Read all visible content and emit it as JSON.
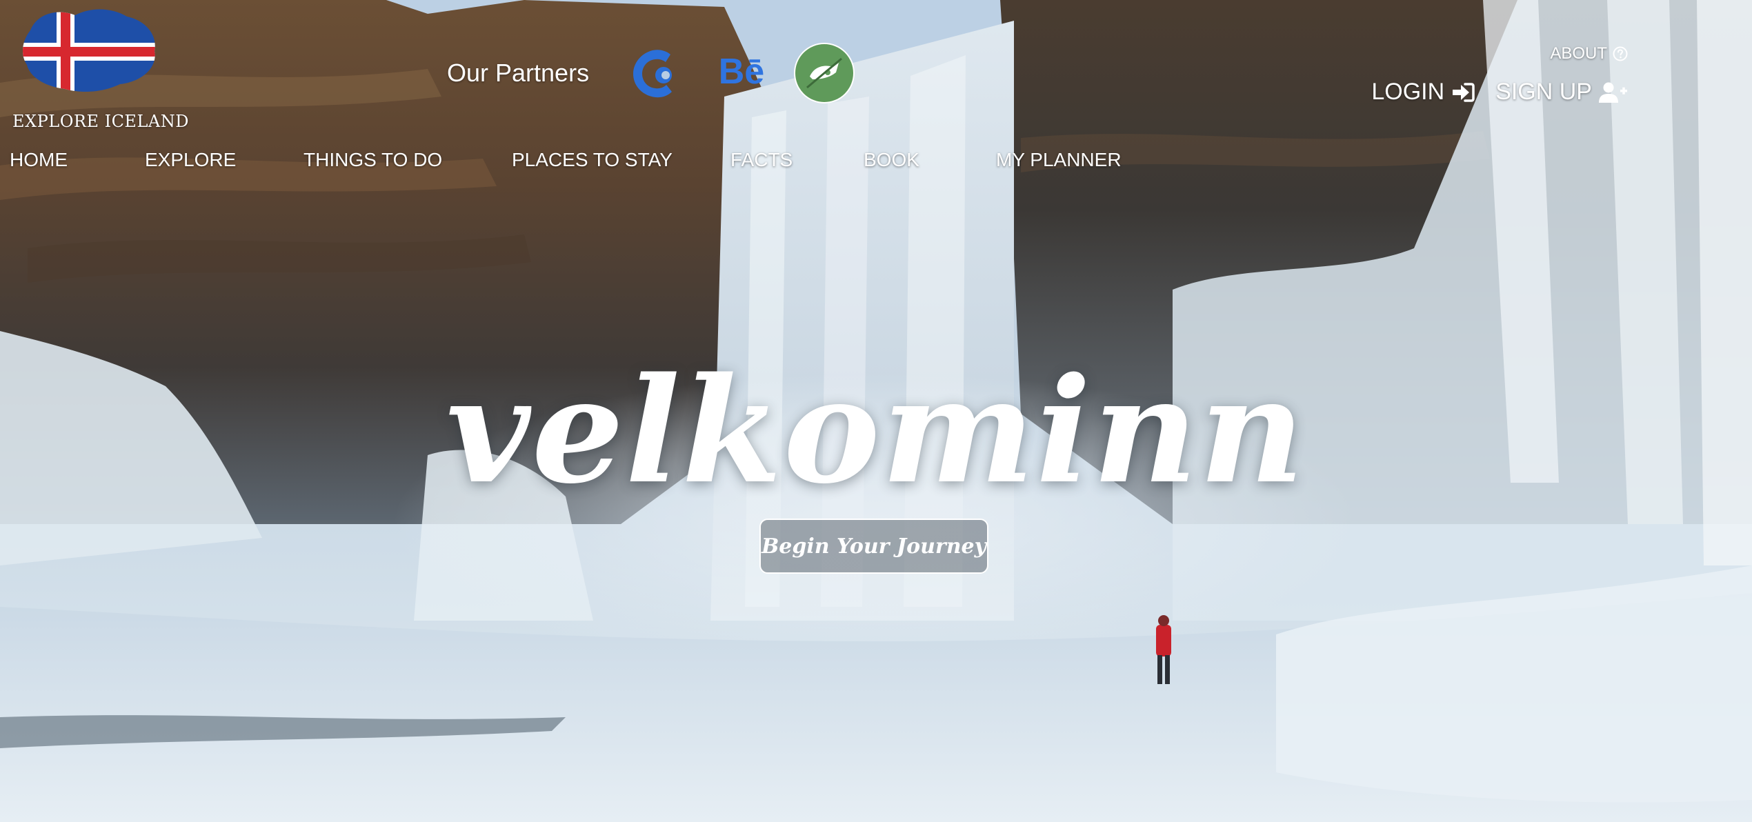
{
  "brand": {
    "logo_text": "EXPLORE ICELAND",
    "flag_colors": {
      "blue": "#1e4fa8",
      "white": "#ffffff",
      "red": "#d7282f"
    }
  },
  "partners": {
    "label": "Our Partners",
    "items": [
      {
        "icon": "codepen-c-icon",
        "color": "#2b6fd8"
      },
      {
        "icon": "behance-icon",
        "text": "Bē",
        "color": "#2f74e0"
      },
      {
        "icon": "deviantart-icon",
        "color": "#5f9a5a"
      }
    ]
  },
  "top_links": {
    "about": "ABOUT",
    "login": "LOGIN",
    "signup": "SIGN UP"
  },
  "nav": {
    "items": [
      "HOME",
      "EXPLORE",
      "THINGS TO DO",
      "PLACES TO STAY",
      "FACTS",
      "BOOK",
      "MY PLANNER"
    ]
  },
  "hero": {
    "headline": "velkominn",
    "cta": "Begin Your Journey"
  }
}
